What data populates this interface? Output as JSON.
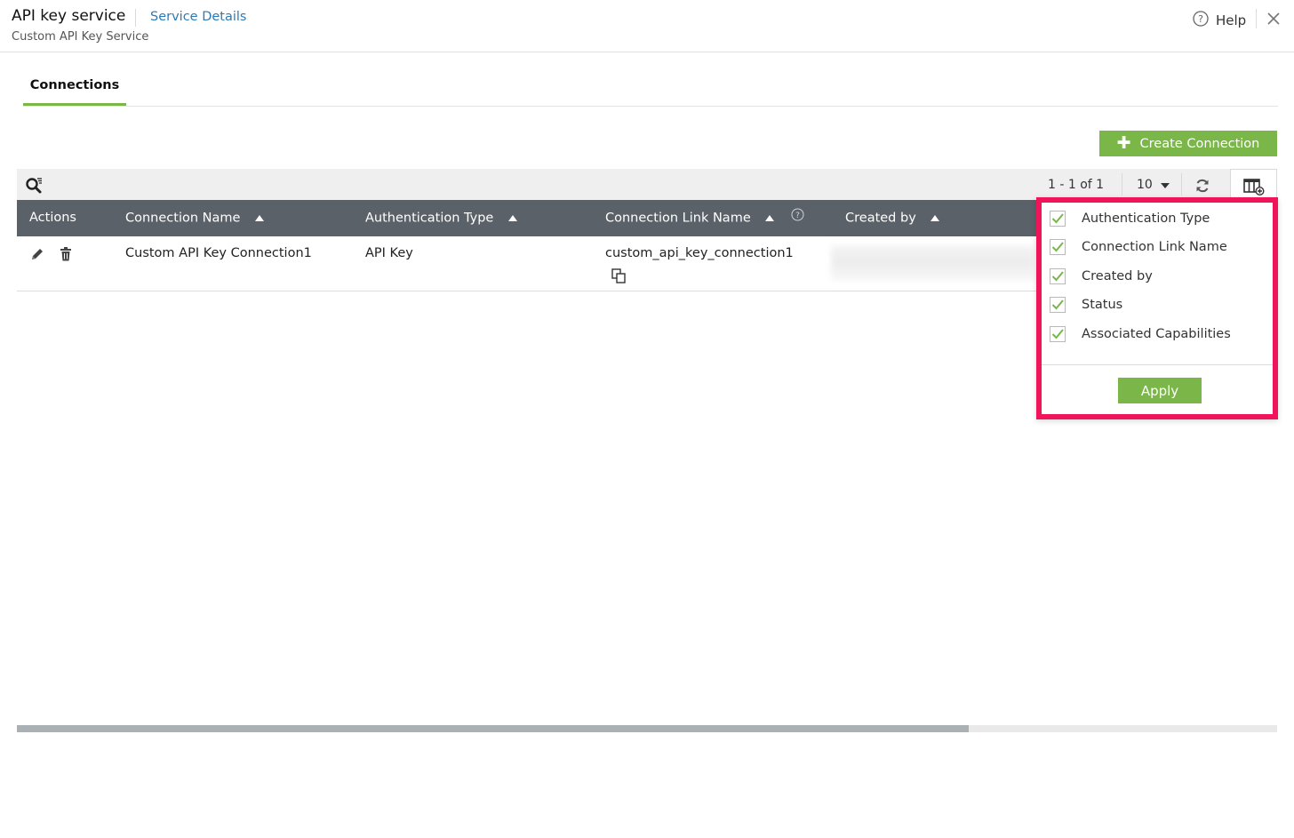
{
  "header": {
    "app_title": "API key service",
    "service_details_link": "Service Details",
    "subtitle": "Custom API Key Service",
    "help_label": "Help"
  },
  "tabs": [
    {
      "label": "Connections",
      "active": true
    }
  ],
  "toolbar": {
    "create_button_label": "Create Connection",
    "pagination_text": "1 - 1 of 1",
    "page_size": "10"
  },
  "table": {
    "columns": [
      {
        "label": "Actions",
        "sortable": false
      },
      {
        "label": "Connection Name",
        "sortable": true
      },
      {
        "label": "Authentication Type",
        "sortable": true
      },
      {
        "label": "Connection Link Name",
        "sortable": true,
        "help": true
      },
      {
        "label": "Created by",
        "sortable": true
      }
    ],
    "rows": [
      {
        "connection_name": "Custom API Key Connection1",
        "authentication_type": "API Key",
        "connection_link_name": "custom_api_key_connection1",
        "created_by": ""
      }
    ]
  },
  "column_chooser": {
    "options": [
      {
        "label": "Authentication Type",
        "checked": true
      },
      {
        "label": "Connection Link Name",
        "checked": true
      },
      {
        "label": "Created by",
        "checked": true
      },
      {
        "label": "Status",
        "checked": true
      },
      {
        "label": "Associated Capabilities",
        "checked": true
      }
    ],
    "apply_label": "Apply"
  },
  "colors": {
    "accent_green": "#7ab648",
    "highlight_border": "#f0145a",
    "table_header_bg": "#5a6168",
    "link_blue": "#2c7bb6"
  }
}
